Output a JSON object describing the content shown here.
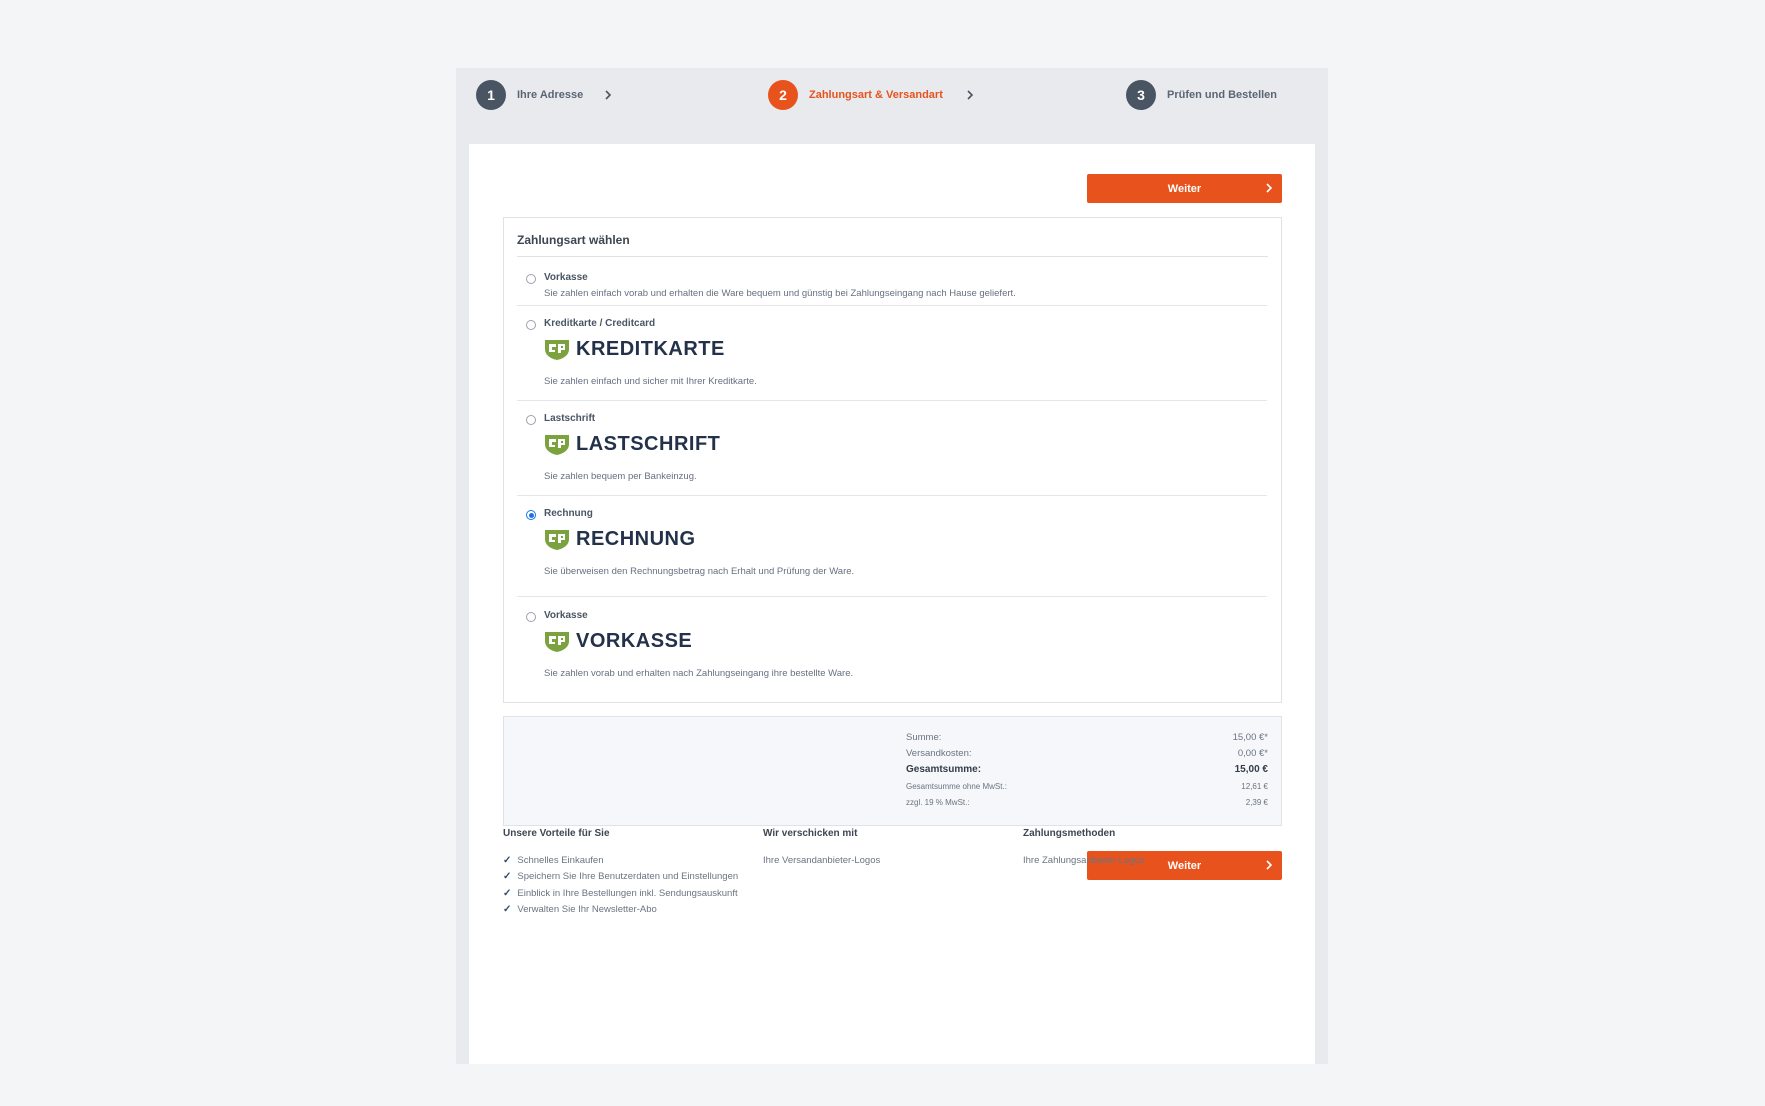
{
  "steps": [
    {
      "number": "1",
      "label": "Ihre Adresse"
    },
    {
      "number": "2",
      "label": "Zahlungsart & Versandart"
    },
    {
      "number": "3",
      "label": "Prüfen und Bestellen"
    }
  ],
  "buttons": {
    "next_label": "Weiter"
  },
  "payment": {
    "title": "Zahlungsart wählen",
    "selected": "Rechnung",
    "options": [
      {
        "name": "Vorkasse",
        "brand": "",
        "description": "Sie zahlen einfach vorab und erhalten die Ware bequem und günstig bei Zahlungseingang nach Hause geliefert."
      },
      {
        "name": "Kreditkarte / Creditcard",
        "brand": "KREDITKARTE",
        "description": "Sie zahlen einfach und sicher mit Ihrer Kreditkarte."
      },
      {
        "name": "Lastschrift",
        "brand": "LASTSCHRIFT",
        "description": "Sie zahlen bequem per Bankeinzug."
      },
      {
        "name": "Rechnung",
        "brand": "RECHNUNG",
        "description": "Sie überweisen den Rechnungsbetrag nach Erhalt und Prüfung der Ware."
      },
      {
        "name": "Vorkasse",
        "brand": "VORKASSE",
        "description": "Sie zahlen vorab und erhalten nach Zahlungseingang ihre bestellte Ware."
      }
    ]
  },
  "summary": {
    "rows": [
      {
        "label": "Summe:",
        "value": "15,00 €*"
      },
      {
        "label": "Versandkosten:",
        "value": "0,00 €*"
      },
      {
        "label": "Gesamtsumme:",
        "value": "15,00 €"
      },
      {
        "label": "Gesamtsumme ohne MwSt.:",
        "value": "12,61 €"
      },
      {
        "label": "zzgl. 19 % MwSt.:",
        "value": "2,39 €"
      }
    ]
  },
  "footer": {
    "advantages": {
      "title": "Unsere Vorteile für Sie",
      "items": [
        "Schnelles Einkaufen",
        "Speichern Sie Ihre Benutzerdaten und Einstellungen",
        "Einblick in Ihre Bestellungen inkl. Sendungsauskunft",
        "Verwalten Sie Ihr Newsletter-Abo"
      ]
    },
    "shipping": {
      "title": "Wir verschicken mit",
      "text": "Ihre Versandanbieter-Logos"
    },
    "payment_methods": {
      "title": "Zahlungsmethoden",
      "text": "Ihre Zahlungsanbieter-Logos"
    }
  },
  "colors": {
    "accent": "#e8521c",
    "step_inactive": "#4a5563",
    "brand_green": "#7ba23f",
    "brand_navy": "#23324a",
    "radio_selected": "#1a73e8"
  }
}
